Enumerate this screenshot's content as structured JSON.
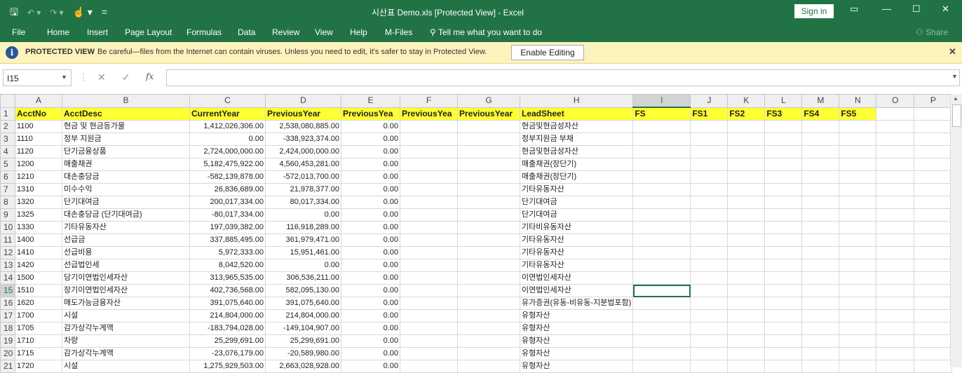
{
  "window": {
    "title": "시산표 Demo.xls  [Protected View]  -  Excel",
    "sign_in": "Sign in",
    "qat": {
      "save": "🖫",
      "undo": "↶ ▾",
      "redo": "↷ ▾",
      "touch": "☝ ▾",
      "customize": "="
    }
  },
  "menu": [
    "File",
    "Home",
    "Insert",
    "Page Layout",
    "Formulas",
    "Data",
    "Review",
    "View",
    "Help",
    "M-Files",
    "Tell me what you want to do",
    "Share"
  ],
  "protected_view": {
    "title": "PROTECTED VIEW",
    "message": "Be careful—files from the Internet can contain viruses. Unless you need to edit, it's safer to stay in Protected View.",
    "button": "Enable Editing"
  },
  "formula_bar": {
    "name_box": "I15",
    "fx": "fx",
    "value": ""
  },
  "columns": [
    "A",
    "B",
    "C",
    "D",
    "E",
    "F",
    "G",
    "H",
    "I",
    "J",
    "K",
    "L",
    "M",
    "N",
    "O",
    "P"
  ],
  "selected_column": "I",
  "selected_row": "15",
  "header_row": [
    "AcctNo",
    "AcctDesc",
    "CurrentYear",
    "PreviousYear",
    "PreviousYea",
    "PreviousYea",
    "PreviousYear",
    "LeadSheet",
    "FS",
    "FS1",
    "FS2",
    "FS3",
    "FS4",
    "FS5",
    "",
    ""
  ],
  "rows": [
    {
      "n": "2",
      "acct": "1100",
      "desc": "현금 및 현금등가물",
      "cur": "1,412,026,306.00",
      "prev": "2,538,080,885.00",
      "e": "0.00",
      "lead": "현금및현금성자산"
    },
    {
      "n": "3",
      "acct": "1110",
      "desc": "정부 지원금",
      "cur": "0.00",
      "prev": "-338,923,374.00",
      "e": "0.00",
      "lead": "정부지원금 부채"
    },
    {
      "n": "4",
      "acct": "1120",
      "desc": "단기금융상품",
      "cur": "2,724,000,000.00",
      "prev": "2,424,000,000.00",
      "e": "0.00",
      "lead": "현금및현금성자산"
    },
    {
      "n": "5",
      "acct": "1200",
      "desc": "매출채권",
      "cur": "5,182,475,922.00",
      "prev": "4,560,453,281.00",
      "e": "0.00",
      "lead": "매출채권(장단기)"
    },
    {
      "n": "6",
      "acct": "1210",
      "desc": "대손충당금",
      "cur": "-582,139,878.00",
      "prev": "-572,013,700.00",
      "e": "0.00",
      "lead": "매출채권(장단기)"
    },
    {
      "n": "7",
      "acct": "1310",
      "desc": "미수수익",
      "cur": "26,836,689.00",
      "prev": "21,978,377.00",
      "e": "0.00",
      "lead": "기타유동자산"
    },
    {
      "n": "8",
      "acct": "1320",
      "desc": "단기대여금",
      "cur": "200,017,334.00",
      "prev": "80,017,334.00",
      "e": "0.00",
      "lead": "단기대여금"
    },
    {
      "n": "9",
      "acct": "1325",
      "desc": "대손충당금 (단기대여금)",
      "cur": "-80,017,334.00",
      "prev": "0.00",
      "e": "0.00",
      "lead": "단기대여금"
    },
    {
      "n": "10",
      "acct": "1330",
      "desc": "기타유동자산",
      "cur": "197,039,382.00",
      "prev": "116,918,289.00",
      "e": "0.00",
      "lead": "기타비유동자산"
    },
    {
      "n": "11",
      "acct": "1400",
      "desc": "선급금",
      "cur": "337,885,495.00",
      "prev": "361,979,471.00",
      "e": "0.00",
      "lead": "기타유동자산"
    },
    {
      "n": "12",
      "acct": "1410",
      "desc": "선급비용",
      "cur": "5,972,333.00",
      "prev": "15,951,461.00",
      "e": "0.00",
      "lead": "기타유동자산"
    },
    {
      "n": "13",
      "acct": "1420",
      "desc": "선급법인세",
      "cur": "8,042,520.00",
      "prev": "0.00",
      "e": "0.00",
      "lead": "기타유동자산"
    },
    {
      "n": "14",
      "acct": "1500",
      "desc": "당기이연법인세자산",
      "cur": "313,965,535.00",
      "prev": "306,536,211.00",
      "e": "0.00",
      "lead": "이연법인세자산"
    },
    {
      "n": "15",
      "acct": "1510",
      "desc": "장기이연법인세자산",
      "cur": "402,736,568.00",
      "prev": "582,095,130.00",
      "e": "0.00",
      "lead": "이연법인세자산"
    },
    {
      "n": "16",
      "acct": "1620",
      "desc": "매도가능금융자산",
      "cur": "391,075,640.00",
      "prev": "391,075,640.00",
      "e": "0.00",
      "lead": "유가증권(유동-비유동-지분법포함)"
    },
    {
      "n": "17",
      "acct": "1700",
      "desc": "시설",
      "cur": "214,804,000.00",
      "prev": "214,804,000.00",
      "e": "0.00",
      "lead": "유형자산"
    },
    {
      "n": "18",
      "acct": "1705",
      "desc": "감가상각누계액",
      "cur": "-183,794,028.00",
      "prev": "-149,104,907.00",
      "e": "0.00",
      "lead": "유형자산"
    },
    {
      "n": "19",
      "acct": "1710",
      "desc": "차량",
      "cur": "25,299,691.00",
      "prev": "25,299,691.00",
      "e": "0.00",
      "lead": "유형자산"
    },
    {
      "n": "20",
      "acct": "1715",
      "desc": "감가상각누계액",
      "cur": "-23,076,179.00",
      "prev": "-20,589,980.00",
      "e": "0.00",
      "lead": "유형자산"
    },
    {
      "n": "21",
      "acct": "1720",
      "desc": "시설",
      "cur": "1,275,929,503.00",
      "prev": "2,663,028,928.00",
      "e": "0.00",
      "lead": "유형자산"
    }
  ],
  "colors": {
    "excel_green": "#217346",
    "header_yellow": "#ffff33",
    "banner": "#fcf3bd"
  }
}
